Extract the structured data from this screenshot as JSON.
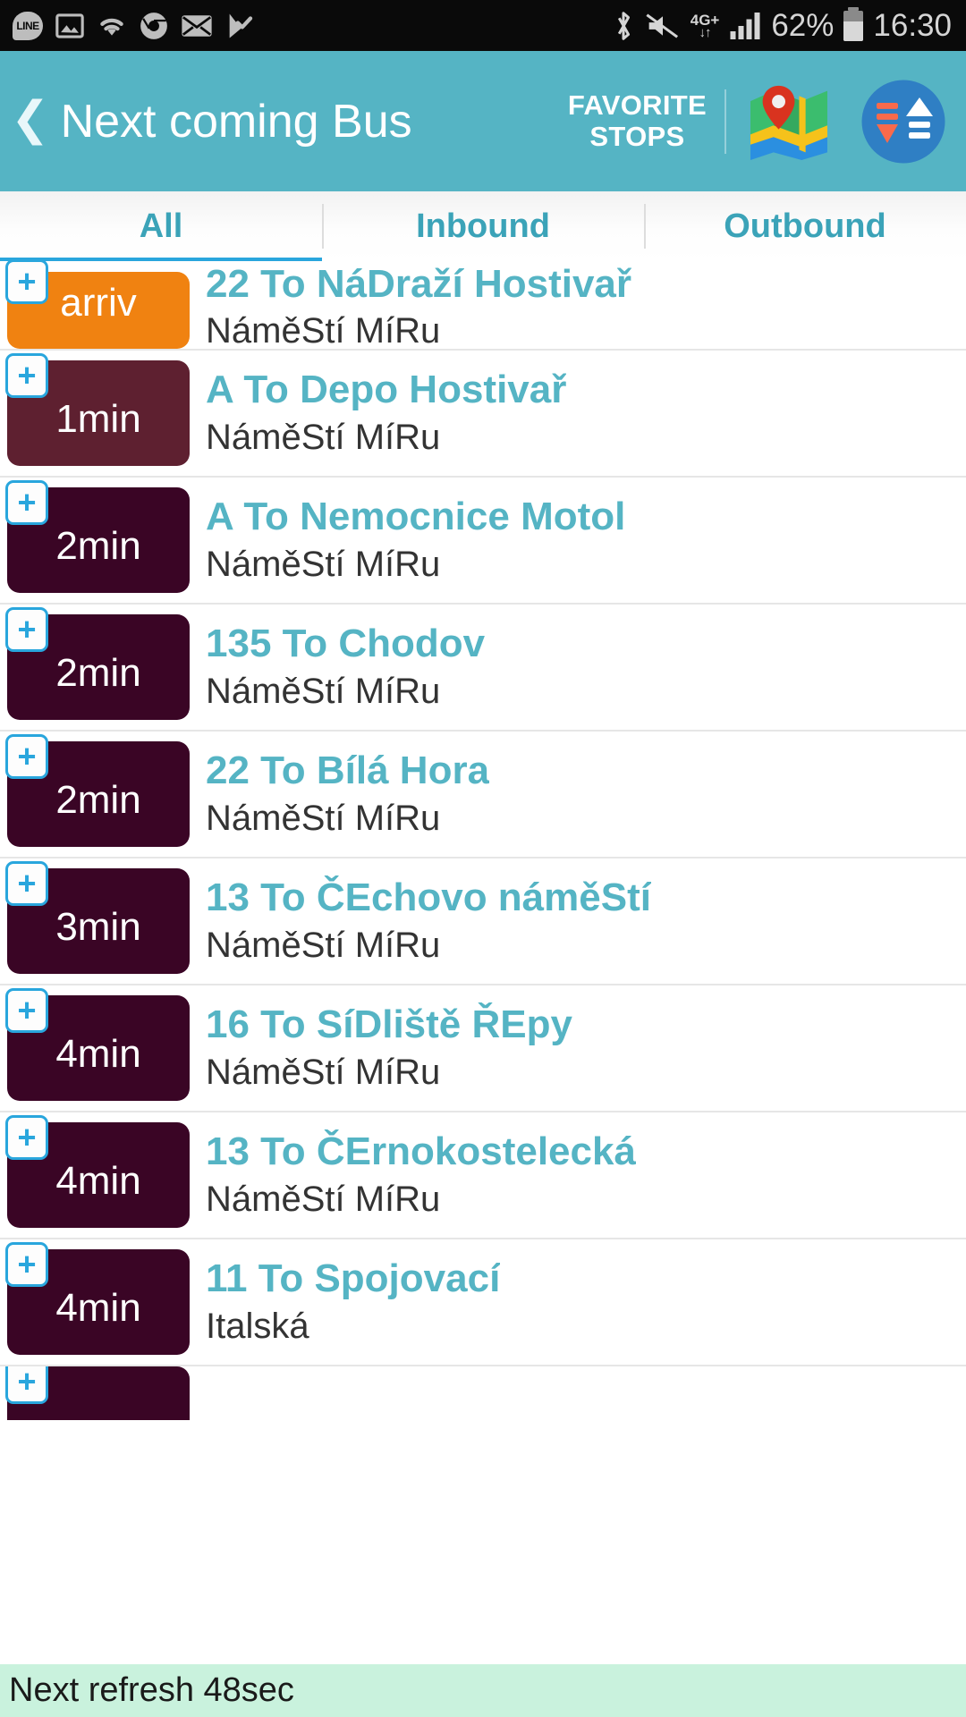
{
  "status_bar": {
    "left_icons": [
      "line-icon",
      "gallery-icon",
      "wifi-icon",
      "chrome-icon",
      "mail-icon",
      "check-play-icon"
    ],
    "line_label": "LINE",
    "bluetooth_icon": "bluetooth-icon",
    "mute_icon": "volume-mute-icon",
    "network_label": "4G+",
    "network_arrows": "↓↑",
    "signal_icon": "signal-bars-icon",
    "battery_percent": "62%",
    "battery_icon": "battery-icon",
    "clock": "16:30"
  },
  "app_bar": {
    "back_icon": "back-chevron-icon",
    "title": "Next coming Bus",
    "favorite_stops_label": "FAVORITE\nSTOPS",
    "map_icon": "map-pin-icon",
    "refresh_icon": "sync-refresh-icon",
    "background_color": "#55b4c4"
  },
  "tabs": {
    "active_index": 0,
    "items": [
      {
        "label": "All"
      },
      {
        "label": "Inbound"
      },
      {
        "label": "Outbound"
      }
    ],
    "indicator_color": "#29a6dd",
    "text_color": "#3ba3b8"
  },
  "departures": [
    {
      "time": "arriv",
      "route": "22 To NáDraží Hostivař",
      "stop": "NáměStí MíRu",
      "color": "#f08211",
      "add_icon": "plus-icon",
      "partial_top": true
    },
    {
      "time": "1min",
      "route": "A To Depo Hostivař",
      "stop": "NáměStí MíRu",
      "color": "#5e2030",
      "add_icon": "plus-icon"
    },
    {
      "time": "2min",
      "route": "A To Nemocnice Motol",
      "stop": "NáměStí MíRu",
      "color": "#3a0525",
      "add_icon": "plus-icon"
    },
    {
      "time": "2min",
      "route": "135 To Chodov",
      "stop": "NáměStí MíRu",
      "color": "#3a0525",
      "add_icon": "plus-icon"
    },
    {
      "time": "2min",
      "route": "22 To Bílá Hora",
      "stop": "NáměStí MíRu",
      "color": "#3a0525",
      "add_icon": "plus-icon"
    },
    {
      "time": "3min",
      "route": "13 To ČEchovo náměStí",
      "stop": "NáměStí MíRu",
      "color": "#3a0525",
      "add_icon": "plus-icon"
    },
    {
      "time": "4min",
      "route": "16 To SíDliště ŘEpy",
      "stop": "NáměStí MíRu",
      "color": "#3a0525",
      "add_icon": "plus-icon"
    },
    {
      "time": "4min",
      "route": "13 To ČErnokostelecká",
      "stop": "NáměStí MíRu",
      "color": "#3a0525",
      "add_icon": "plus-icon"
    },
    {
      "time": "4min",
      "route": "11 To Spojovací",
      "stop": "Italská",
      "color": "#3a0525",
      "add_icon": "plus-icon"
    },
    {
      "time": "",
      "route": "",
      "stop": "",
      "color": "#3a0525",
      "add_icon": "plus-icon",
      "partial_bottom": true
    }
  ],
  "footer": {
    "text": "Next refresh 48sec",
    "background_color": "#c9f2dd"
  }
}
